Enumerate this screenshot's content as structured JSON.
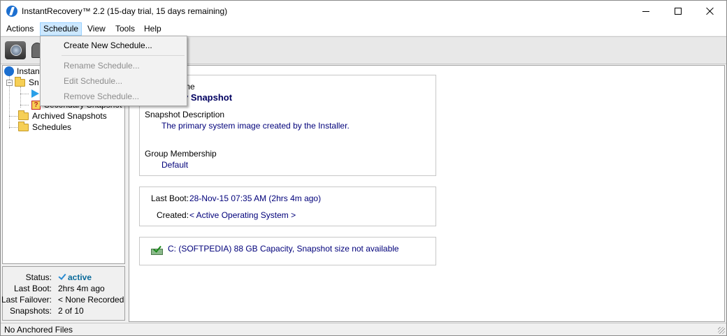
{
  "window": {
    "title": "InstantRecovery™ 2.2 (15-day trial, 15 days remaining)"
  },
  "menubar": {
    "items": [
      "Actions",
      "Schedule",
      "View",
      "Tools",
      "Help"
    ]
  },
  "schedule_menu": {
    "items": [
      {
        "label": "Create New Schedule...",
        "enabled": true
      },
      {
        "label": "Rename Schedule...",
        "enabled": false
      },
      {
        "label": "Edit Schedule...",
        "enabled": false
      },
      {
        "label": "Remove Schedule...",
        "enabled": false
      }
    ]
  },
  "tree": {
    "root_label": "Instant",
    "snapshots_label": "Sn",
    "secondary_label": "Secondary Snapshot",
    "archived_label": "Archived Snapshots",
    "schedules_label": "Schedules"
  },
  "status": {
    "status_label": "Status:",
    "status_value": "active",
    "last_boot_label": "Last Boot:",
    "last_boot_value": "2hrs 4m ago",
    "last_failover_label": "Last Failover:",
    "last_failover_value": "< None Recorded >",
    "snapshots_label": "Snapshots:",
    "snapshots_value": "2 of 10"
  },
  "details": {
    "name_label": "me",
    "name_value": "y Snapshot",
    "description_label": "Snapshot Description",
    "description_value": "The primary system image created by the Installer.",
    "group_label": "Group Membership",
    "group_value": "Default",
    "last_boot_label": "Last Boot:",
    "last_boot_value": "28-Nov-15 07:35 AM (2hrs 4m ago)",
    "created_label": "Created:",
    "created_value": "< Active Operating System >",
    "drive_text": "C: (SOFTPEDIA) 88 GB Capacity, Snapshot size not available"
  },
  "statusbar": {
    "text": "No Anchored Files"
  },
  "colors": {
    "menu_highlight": "#cce8ff",
    "value_text": "#00007a",
    "status_active": "#0a6a9a",
    "disabled_text": "#8d8d8d"
  }
}
